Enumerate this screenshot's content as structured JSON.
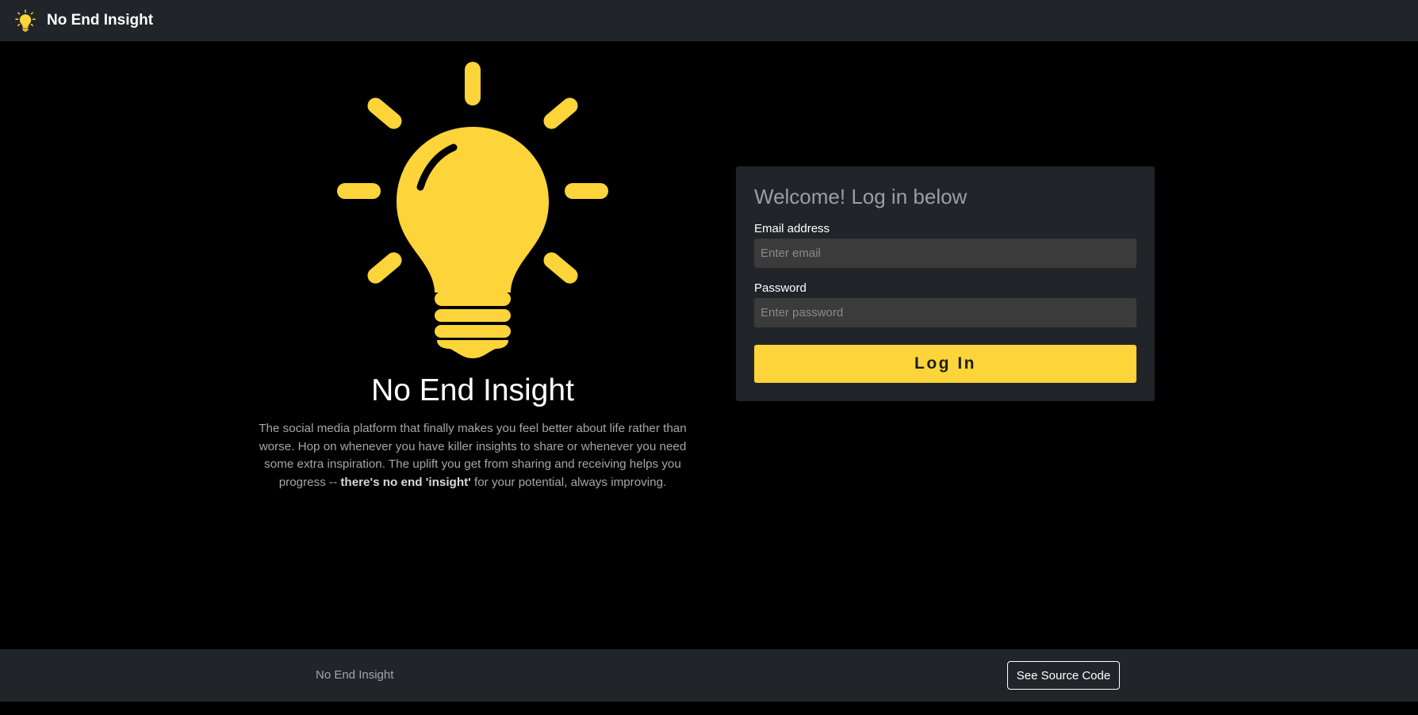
{
  "navbar": {
    "brand_icon": "lightbulb-icon",
    "brand_title": "No End Insight"
  },
  "hero": {
    "icon": "lightbulb-icon",
    "title": "No End Insight",
    "description_start": "The social media platform that finally makes you feel better about life rather than worse. Hop on whenever you have killer insights to share or whenever you need some extra inspiration. The uplift you get from sharing and receiving helps you progress -- ",
    "description_bold": "there's no end 'insight'",
    "description_end": " for your potential, always improving."
  },
  "login": {
    "heading": "Welcome! Log in below",
    "email_label": "Email address",
    "email_placeholder": "Enter email",
    "email_value": "",
    "password_label": "Password",
    "password_placeholder": "Enter password",
    "password_value": "",
    "submit_label": "Log In"
  },
  "footer": {
    "text": "No End Insight",
    "source_button_label": "See Source Code"
  },
  "colors": {
    "accent": "#fdd43a",
    "background": "#000000",
    "surface": "#212529",
    "input_background": "#3b3b3b"
  }
}
